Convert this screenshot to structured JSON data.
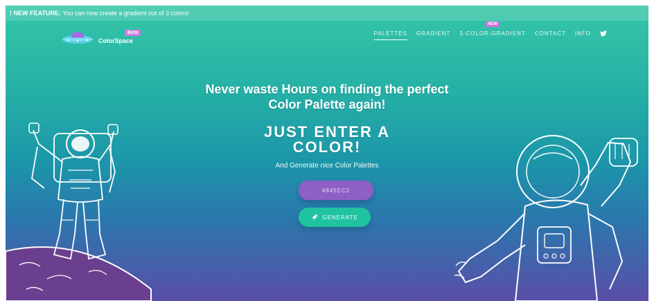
{
  "banner": {
    "prefix": "! NEW FEATURE:",
    "text": "You can now create a gradient out of 3 colors!"
  },
  "logo": {
    "name": "ColorSpace",
    "badge": "Beta"
  },
  "nav": {
    "items": [
      {
        "label": "PALETTES",
        "active": true
      },
      {
        "label": "GRADIENT"
      },
      {
        "label": "3-COLOR-GRADIENT",
        "badge": "NEW"
      },
      {
        "label": "CONTACT"
      },
      {
        "label": "INFO"
      }
    ],
    "twitter_icon": "twitter-icon"
  },
  "hero": {
    "headline_line1": "Never waste Hours on finding the perfect",
    "headline_line2": "Color Palette again!",
    "subhead_line1": "JUST ENTER A",
    "subhead_line2": "COLOR!",
    "tagline": "And Generate nice Color Palettes",
    "input_placeholder": "#845EC2",
    "generate_label": "GENERATE",
    "generate_icon": "rocket-icon"
  },
  "colors": {
    "gradient_top": "#35c6a7",
    "gradient_bottom": "#5a4ea8",
    "input_bg": "#8e5fc4",
    "button_bg": "#1fc39f",
    "badge": "#d07cdf"
  }
}
